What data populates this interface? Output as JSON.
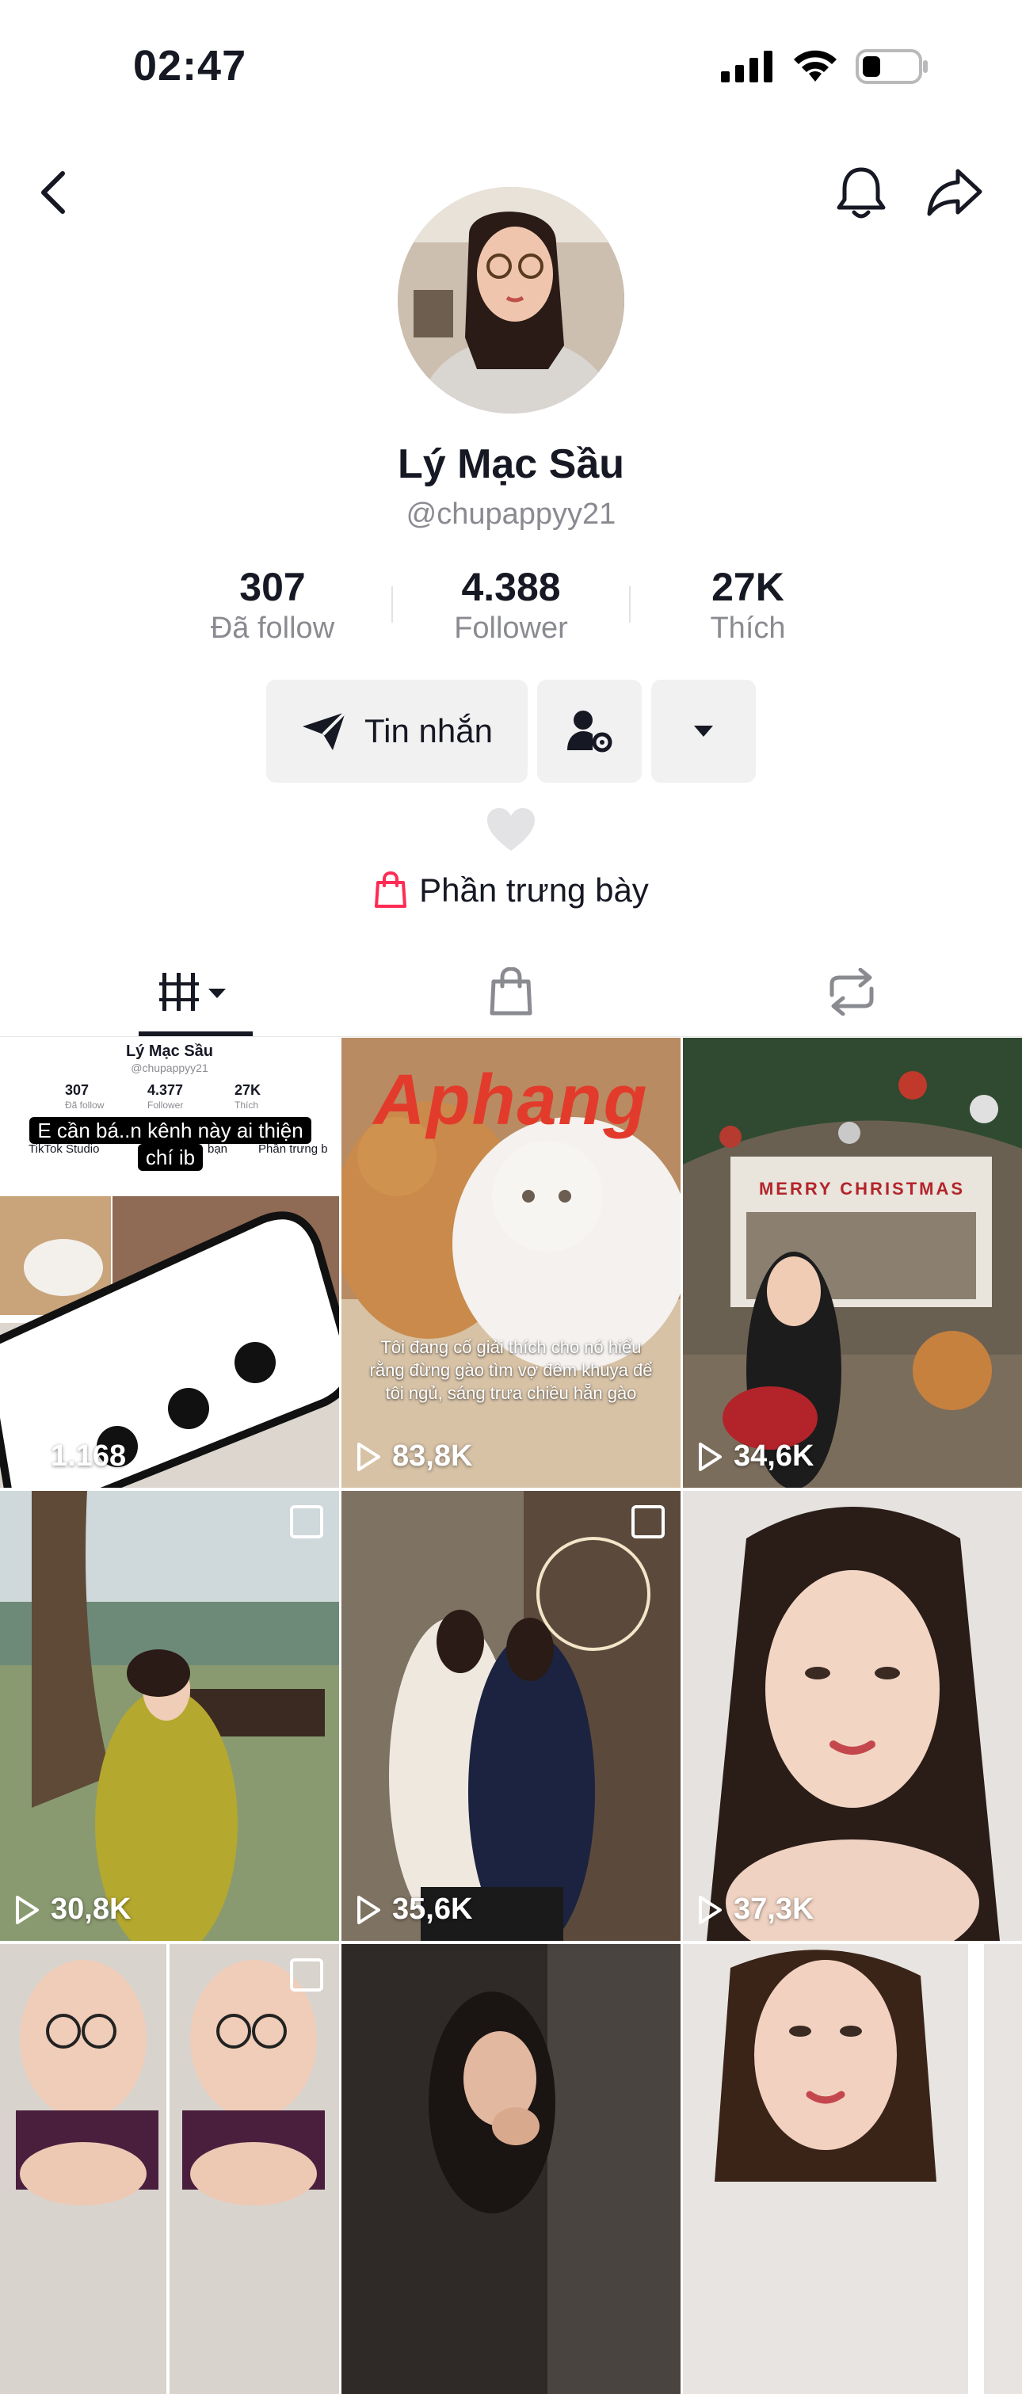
{
  "status": {
    "time": "02:47"
  },
  "profile": {
    "name": "Lý Mạc Sầu",
    "handle": "@chupappyy21",
    "stats": [
      {
        "value": "307",
        "label": "Đã follow"
      },
      {
        "value": "4.388",
        "label": "Follower"
      },
      {
        "value": "27K",
        "label": "Thích"
      }
    ]
  },
  "actions": {
    "message_label": "Tin nhắn"
  },
  "showcase": {
    "label": "Phần trưng bày"
  },
  "tabs": [
    {
      "icon": "videos-grid-icon",
      "selected": true
    },
    {
      "icon": "shopping-bag-icon",
      "selected": false
    },
    {
      "icon": "repost-icon",
      "selected": false
    }
  ],
  "videos": [
    {
      "views": "1.168",
      "overlay": "E cần bá..n kênh này ai thiện chí ib",
      "inner_name": "Lý Mạc Sầu",
      "inner_handle": "@chupappyy21",
      "inner_stats": [
        "307",
        "4.377",
        "27K"
      ],
      "inner_labels": [
        "Đã follow",
        "Follower",
        "Thích"
      ],
      "inner_menu": [
        "TikTok Studio",
        "bạn",
        "Phần trưng b"
      ]
    },
    {
      "views": "83,8K",
      "brand": "Aphang",
      "caption": "Tôi đang cố giải thích cho nó hiểu rằng đừng gào tìm vợ đêm khuya để tôi ngủ, sáng trưa chiều hẵn gào"
    },
    {
      "views": "34,6K",
      "sign": "MERRY CHRISTMAS"
    },
    {
      "views": "30,8K"
    },
    {
      "views": "35,6K"
    },
    {
      "views": "37,3K"
    },
    {
      "views": ""
    },
    {
      "views": ""
    },
    {
      "views": ""
    }
  ],
  "colors": {
    "accent": "#fe2c55",
    "text": "#161823",
    "muted": "#8a8b91",
    "button_bg": "#f1f1f2"
  }
}
